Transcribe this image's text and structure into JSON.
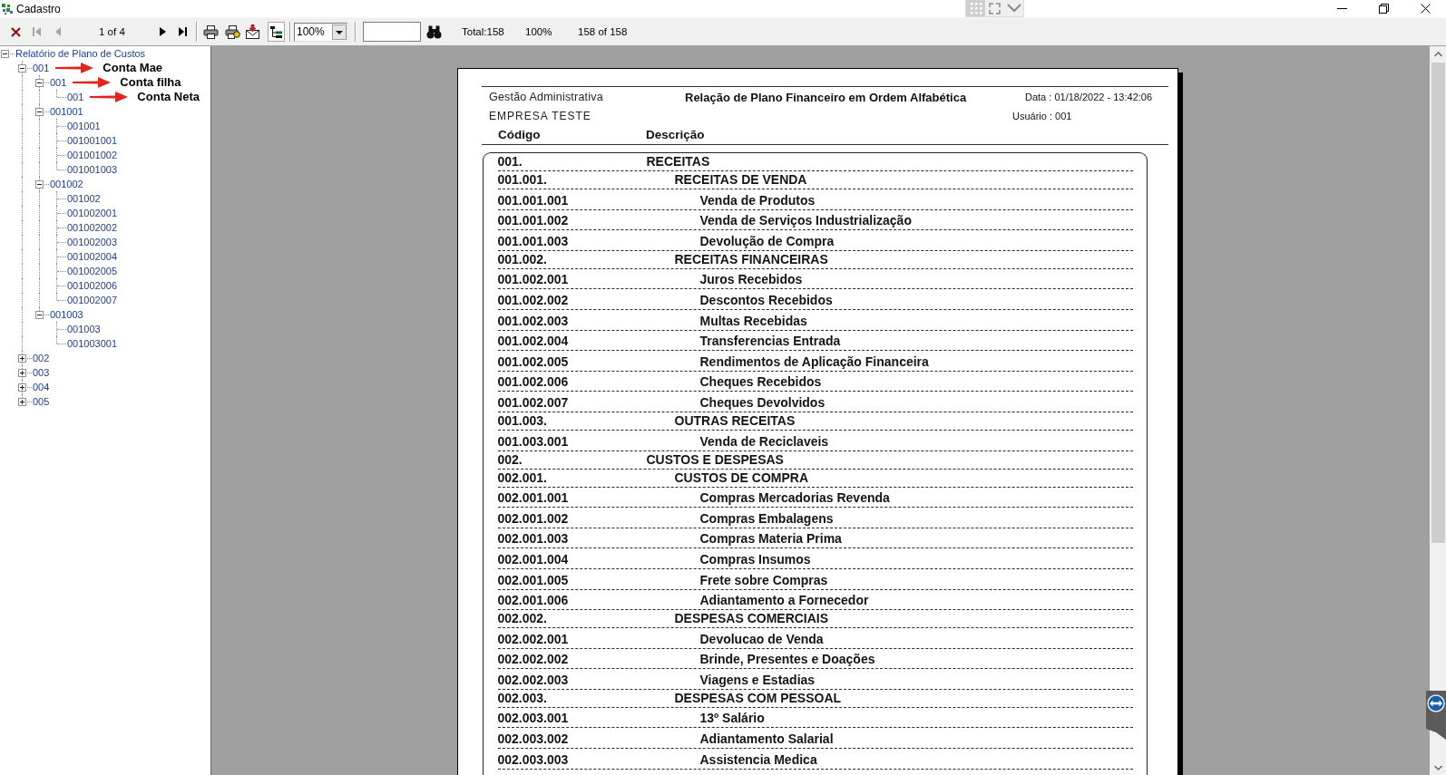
{
  "window": {
    "title": "Cadastro"
  },
  "toolbar": {
    "first_page": {
      "disabled": true
    },
    "previous_page": {
      "disabled": true
    },
    "page_indicator": "1 of 4",
    "next_page": {
      "disabled": false
    },
    "last_page": {
      "disabled": false
    },
    "group_tree_toggle": {
      "pressed": true
    },
    "zoom_select": {
      "value": "100%"
    },
    "total": "Total:158",
    "zoom_level": "100%",
    "record_count": "158 of 158"
  },
  "group_tree": {
    "items": [
      {
        "label": "Relatório de Plano de Custos",
        "expanded": true,
        "children": [
          {
            "label": "001",
            "expanded": true,
            "annotation": "Conta Mae",
            "children": [
              {
                "label": "001",
                "expanded": true,
                "annotation": "Conta filha",
                "children": [
                  {
                    "label": "001",
                    "annotation": "Conta Neta"
                  }
                ]
              },
              {
                "label": "001001",
                "expanded": true,
                "children": [
                  {
                    "label": "001001"
                  },
                  {
                    "label": "001001001"
                  },
                  {
                    "label": "001001002"
                  },
                  {
                    "label": "001001003"
                  }
                ]
              },
              {
                "label": "001002",
                "expanded": true,
                "children": [
                  {
                    "label": "001002"
                  },
                  {
                    "label": "001002001"
                  },
                  {
                    "label": "001002002"
                  },
                  {
                    "label": "001002003"
                  },
                  {
                    "label": "001002004"
                  },
                  {
                    "label": "001002005"
                  },
                  {
                    "label": "001002006"
                  },
                  {
                    "label": "001002007"
                  }
                ]
              },
              {
                "label": "001003",
                "expanded": true,
                "children": [
                  {
                    "label": "001003"
                  },
                  {
                    "label": "001003001"
                  }
                ]
              }
            ]
          },
          {
            "label": "002",
            "expanded": false
          },
          {
            "label": "003",
            "expanded": false
          },
          {
            "label": "004",
            "expanded": false
          },
          {
            "label": "005",
            "expanded": false
          }
        ]
      }
    ]
  },
  "report": {
    "system": "Gestão Administrativa",
    "title": "Relação de Plano Financeiro em Ordem Alfabética",
    "date": "Data : 01/18/2022 - 13:42:06",
    "company": "EMPRESA TESTE",
    "user": "Usuário : 001",
    "columns": [
      "Código",
      "Descrição"
    ],
    "rows": [
      {
        "code": "001.",
        "description": "RECEITAS",
        "children": [
          {
            "code": "001.001.",
            "description": "RECEITAS DE VENDA",
            "children": [
              {
                "code": "001.001.001",
                "description": "Venda de Produtos"
              },
              {
                "code": "001.001.002",
                "description": "Venda de Serviços Industrialização"
              },
              {
                "code": "001.001.003",
                "description": "Devolução de Compra"
              }
            ]
          },
          {
            "code": "001.002.",
            "description": "RECEITAS FINANCEIRAS",
            "children": [
              {
                "code": "001.002.001",
                "description": "Juros Recebidos"
              },
              {
                "code": "001.002.002",
                "description": "Descontos Recebidos"
              },
              {
                "code": "001.002.003",
                "description": "Multas Recebidas"
              },
              {
                "code": "001.002.004",
                "description": "Transferencias Entrada"
              },
              {
                "code": "001.002.005",
                "description": "Rendimentos de Aplicação Financeira"
              },
              {
                "code": "001.002.006",
                "description": "Cheques Recebidos"
              },
              {
                "code": "001.002.007",
                "description": "Cheques Devolvidos"
              }
            ]
          },
          {
            "code": "001.003.",
            "description": "OUTRAS RECEITAS",
            "children": [
              {
                "code": "001.003.001",
                "description": "Venda de Reciclaveis"
              }
            ]
          }
        ]
      },
      {
        "code": "002.",
        "description": "CUSTOS E DESPESAS",
        "children": [
          {
            "code": "002.001.",
            "description": "CUSTOS DE COMPRA",
            "children": [
              {
                "code": "002.001.001",
                "description": "Compras Mercadorias Revenda"
              },
              {
                "code": "002.001.002",
                "description": "Compras Embalagens"
              },
              {
                "code": "002.001.003",
                "description": "Compras Materia Prima"
              },
              {
                "code": "002.001.004",
                "description": "Compras Insumos"
              },
              {
                "code": "002.001.005",
                "description": "Frete sobre Compras"
              },
              {
                "code": "002.001.006",
                "description": "Adiantamento a Fornecedor"
              }
            ]
          },
          {
            "code": "002.002.",
            "description": "DESPESAS COMERCIAIS",
            "children": [
              {
                "code": "002.002.001",
                "description": "Devolucao de Venda"
              },
              {
                "code": "002.002.002",
                "description": "Brinde, Presentes e Doações"
              },
              {
                "code": "002.002.003",
                "description": "Viagens e Estadias"
              }
            ]
          },
          {
            "code": "002.003.",
            "description": "DESPESAS COM PESSOAL",
            "children": [
              {
                "code": "002.003.001",
                "description": "13º Salário"
              },
              {
                "code": "002.003.002",
                "description": "Adiantamento Salarial"
              },
              {
                "code": "002.003.003",
                "description": "Assistencia Medica"
              }
            ]
          }
        ]
      }
    ]
  }
}
